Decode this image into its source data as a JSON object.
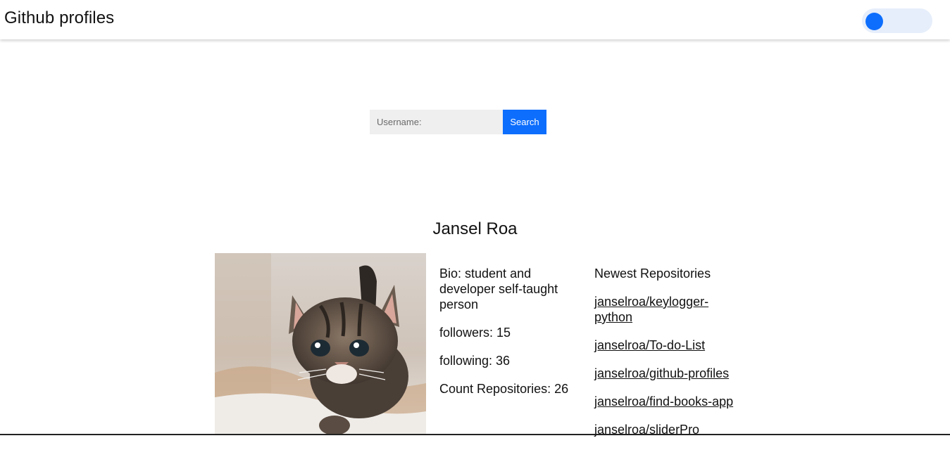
{
  "header": {
    "title": "Github profiles",
    "theme_toggle": {
      "state": "off",
      "accent": "#0d6efd"
    }
  },
  "search": {
    "placeholder": "Username:",
    "value": "",
    "button_label": "Search"
  },
  "profile": {
    "name": "Jansel Roa",
    "avatar_icon": "kitten-photo",
    "bio": "Bio: student and developer self-taught person",
    "followers": "followers: 15",
    "following": "following: 36",
    "repo_count": "Count Repositories: 26"
  },
  "repositories": {
    "heading": "Newest Repositories",
    "items": [
      "janselroa/keylogger-python",
      "janselroa/To-do-List",
      "janselroa/github-profiles",
      "janselroa/find-books-app",
      "janselroa/sliderPro"
    ]
  },
  "colors": {
    "accent": "#0d6efd",
    "toggle_track": "#e6eefb",
    "input_bg": "#efefef"
  }
}
